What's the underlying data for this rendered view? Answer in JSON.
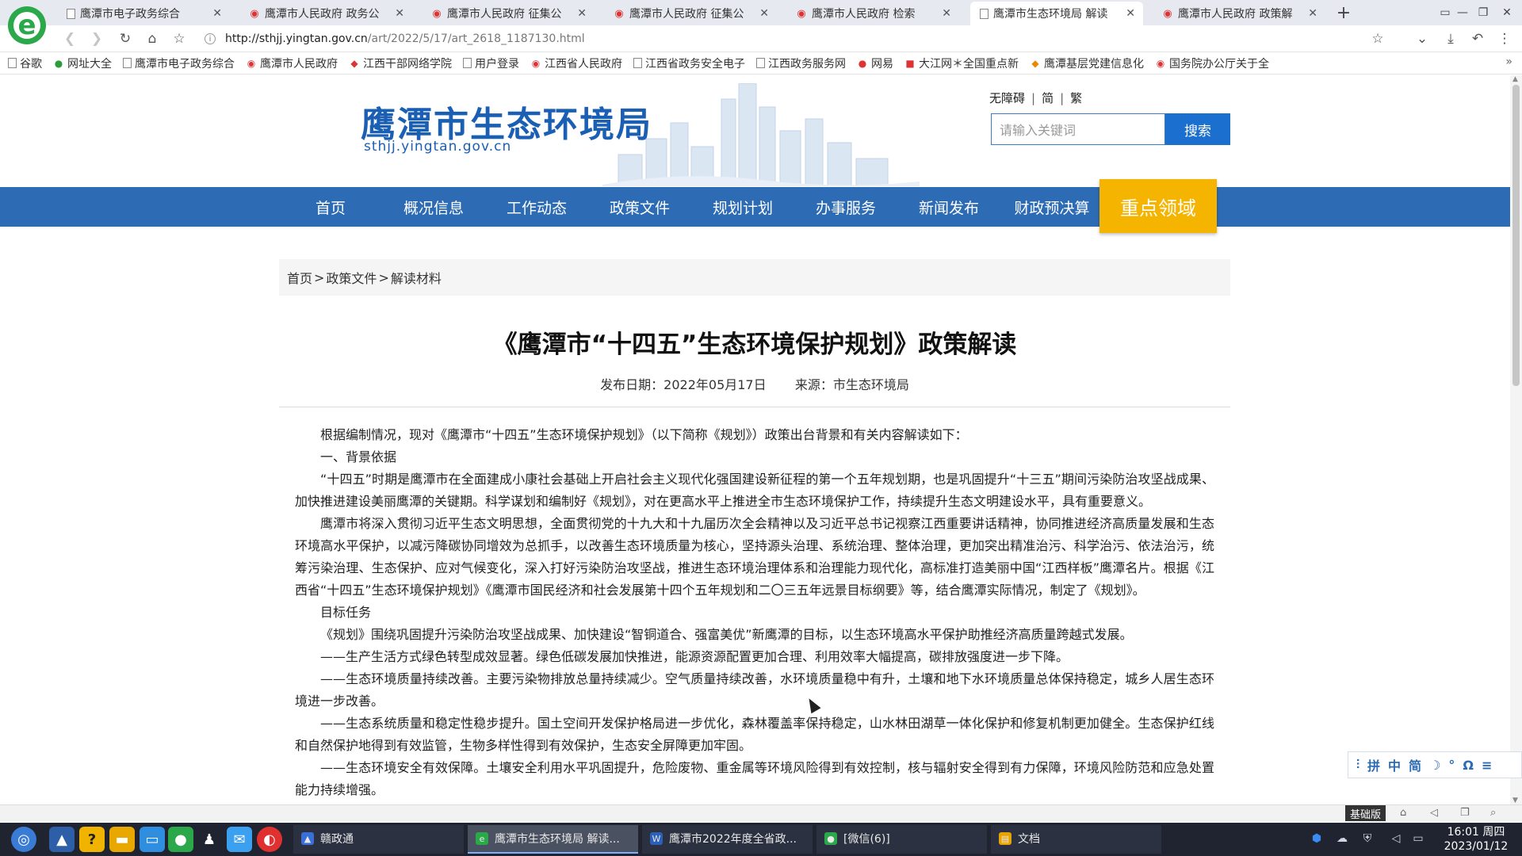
{
  "browser": {
    "tabs": [
      {
        "title": "鹰潭市电子政务综合",
        "icon": "doc"
      },
      {
        "title": "鹰潭市人民政府 政务公",
        "icon": "gov"
      },
      {
        "title": "鹰潭市人民政府 征集公",
        "icon": "gov"
      },
      {
        "title": "鹰潭市人民政府 征集公",
        "icon": "gov"
      },
      {
        "title": "鹰潭市人民政府 检索",
        "icon": "gov"
      },
      {
        "title": "鹰潭市生态环境局 解读",
        "icon": "doc",
        "active": true
      },
      {
        "title": "鹰潭市人民政府 政策解",
        "icon": "gov"
      }
    ],
    "close_glyph": "✕",
    "new_tab_glyph": "+",
    "url_host": "http://sthjj.yingtan.gov.cn",
    "url_path": "/art/2022/5/17/art_2618_1187130.html",
    "bookmarks": [
      {
        "label": "谷歌",
        "icon": "doc"
      },
      {
        "label": "网址大全",
        "icon": "green"
      },
      {
        "label": "鹰潭市电子政务综合",
        "icon": "doc"
      },
      {
        "label": "鹰潭市人民政府",
        "icon": "red"
      },
      {
        "label": "江西干部网络学院",
        "icon": "red"
      },
      {
        "label": "用户登录",
        "icon": "doc"
      },
      {
        "label": "江西省人民政府",
        "icon": "red"
      },
      {
        "label": "江西省政务安全电子",
        "icon": "doc"
      },
      {
        "label": "江西政务服务网",
        "icon": "doc"
      },
      {
        "label": "网易",
        "icon": "red"
      },
      {
        "label": "大江网＊全国重点新",
        "icon": "red"
      },
      {
        "label": "鹰潭基层党建信息化",
        "icon": "orange"
      },
      {
        "label": "国务院办公厅关于全",
        "icon": "red"
      }
    ],
    "bookmarks_more": "»"
  },
  "site": {
    "title": "鹰潭市生态环境局",
    "domain": "sthjj.yingtan.gov.cn",
    "tools": [
      "无障碍",
      "简",
      "繁"
    ],
    "search_placeholder": "请输入关键词",
    "search_button": "搜索",
    "nav": [
      "首页",
      "概况信息",
      "工作动态",
      "政策文件",
      "规划计划",
      "办事服务",
      "新闻发布",
      "财政预决算"
    ],
    "nav_highlight": "重点领域",
    "brand_color": "#1a5fb4",
    "nav_color": "#2d6bb5",
    "highlight_color": "#f4b400"
  },
  "breadcrumb": [
    "首页",
    "政策文件",
    "解读材料"
  ],
  "breadcrumb_sep": ">",
  "article": {
    "title": "《鹰潭市“十四五”生态环境保护规划》政策解读",
    "date_label": "发布日期：",
    "date": "2022年05月17日",
    "source_label": "来源：",
    "source": "市生态环境局",
    "paragraphs": [
      "根据编制情况，现对《鹰潭市“十四五”生态环境保护规划》（以下简称《规划》）政策出台背景和有关内容解读如下：",
      "一、背景依据",
      "“十四五”时期是鹰潭市在全面建成小康社会基础上开启社会主义现代化强国建设新征程的第一个五年规划期，也是巩固提升“十三五”期间污染防治攻坚战成果、加快推进建设美丽鹰潭的关键期。科学谋划和编制好《规划》，对在更高水平上推进全市生态环境保护工作，持续提升生态文明建设水平，具有重要意义。",
      "鹰潭市将深入贯彻习近平生态文明思想，全面贯彻党的十九大和十九届历次全会精神以及习近平总书记视察江西重要讲话精神，协同推进经济高质量发展和生态环境高水平保护，以减污降碳协同增效为总抓手，以改善生态环境质量为核心，坚持源头治理、系统治理、整体治理，更加突出精准治污、科学治污、依法治污，统筹污染治理、生态保护、应对气候变化，深入打好污染防治攻坚战，推进生态环境治理体系和治理能力现代化，高标准打造美丽中国“江西样板”鹰潭名片。根据《江西省“十四五”生态环境保护规划》《鹰潭市国民经济和社会发展第十四个五年规划和二〇三五年远景目标纲要》等，结合鹰潭实际情况，制定了《规划》。",
      "目标任务",
      "《规划》围绕巩固提升污染防治攻坚战成果、加快建设“智铜道合、强富美优”新鹰潭的目标，以生态环境高水平保护助推经济高质量跨越式发展。",
      "——生产生活方式绿色转型成效显著。绿色低碳发展加快推进，能源资源配置更加合理、利用效率大幅提高，碳排放强度进一步下降。",
      "——生态环境质量持续改善。主要污染物排放总量持续减少。空气质量持续改善，水环境质量稳中有升，土壤和地下水环境质量总体保持稳定，城乡人居生态环境进一步改善。",
      "——生态系统质量和稳定性稳步提升。国土空间开发保护格局进一步优化，森林覆盖率保持稳定，山水林田湖草一体化保护和修复机制更加健全。生态保护红线和自然保护地得到有效监管，生物多样性得到有效保护，生态安全屏障更加牢固。",
      "——生态环境安全有效保障。土壤安全利用水平巩固提升，危险废物、重金属等环境风险得到有效控制，核与辐射安全得到有力保障，环境风险防范和应急处置能力持续增强。"
    ]
  },
  "a11y_toolbar": [
    "拼",
    "中",
    "简",
    "☽",
    "°",
    "Ω",
    "≡"
  ],
  "status_strip": {
    "tag": "基础版"
  },
  "taskbar": {
    "tasks": [
      {
        "label": "赣政通",
        "icon_color": "#3a6fd8"
      },
      {
        "label": "鹰潭市生态环境局 解读...",
        "icon_color": "#2aa84a",
        "active": true
      },
      {
        "label": "鹰潭市2022年度全省政...",
        "icon_color": "#2b5fb8"
      },
      {
        "label": "[微信(6)]",
        "icon_color": "#2aa84a"
      },
      {
        "label": "文档",
        "icon_color": "#e8a300"
      }
    ],
    "clock_time": "16:01 周四",
    "clock_date": "2023/01/12"
  }
}
